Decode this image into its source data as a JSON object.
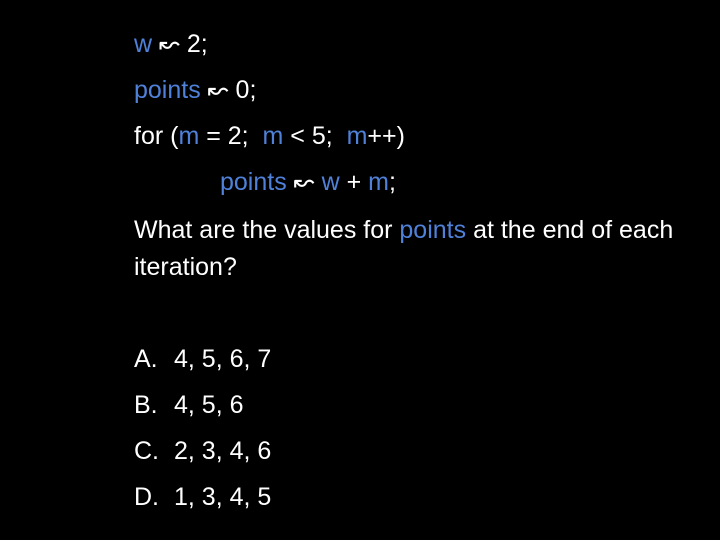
{
  "code": {
    "line1": {
      "var": "w",
      "rest": " ↜ 2;"
    },
    "line2": {
      "var": "points",
      "rest": " ↜ 0;"
    },
    "line3": {
      "p1": "for (",
      "v1": "m",
      "p2": " = 2;  ",
      "v2": "m",
      "p3": " < 5;  ",
      "v3": "m",
      "p4": "++)"
    },
    "line4": {
      "v1": "points",
      "p1": " ↜ ",
      "v2": "w",
      "p2": " + ",
      "v3": "m",
      "p3": ";"
    }
  },
  "question": {
    "before": "What are the values for ",
    "var": "points",
    "after": " at the end of each iteration?"
  },
  "options": [
    {
      "letter": "A.",
      "text": "4, 5, 6, 7"
    },
    {
      "letter": "B.",
      "text": "4, 5, 6"
    },
    {
      "letter": "C.",
      "text": "2, 3, 4, 6"
    },
    {
      "letter": "D.",
      "text": "1, 3, 4, 5"
    }
  ],
  "colors": {
    "background": "#000000",
    "text": "#ffffff",
    "variable": "#4f81d9"
  }
}
